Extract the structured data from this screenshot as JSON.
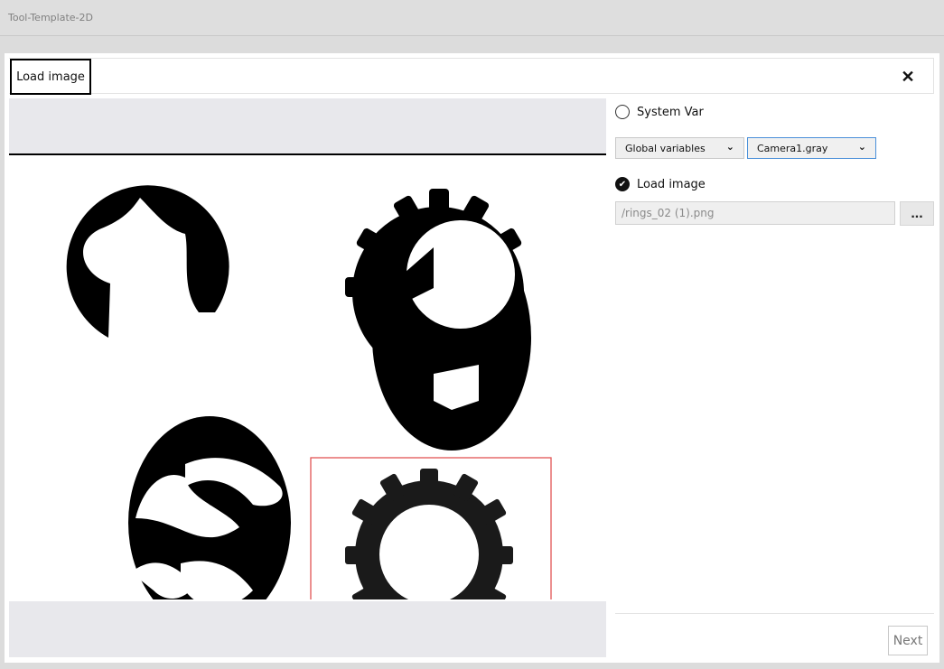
{
  "window": {
    "title": "Tool-Template-2D"
  },
  "tab": {
    "label": "Load image"
  },
  "options": {
    "system_var_label": "System Var",
    "variable_scope_selected": "Global variables",
    "variable_name_selected": "Camera1.gray",
    "load_image_label": "Load image"
  },
  "file": {
    "path": "/rings_02 (1).png",
    "browse_label": "..."
  },
  "footer": {
    "next_label": "Next"
  },
  "icons": {
    "close": "close-icon",
    "chevron": "chevron-down-icon",
    "check": "check-icon"
  },
  "colors": {
    "selection_box": "#e25555",
    "active_select_border": "#4a90d9"
  }
}
